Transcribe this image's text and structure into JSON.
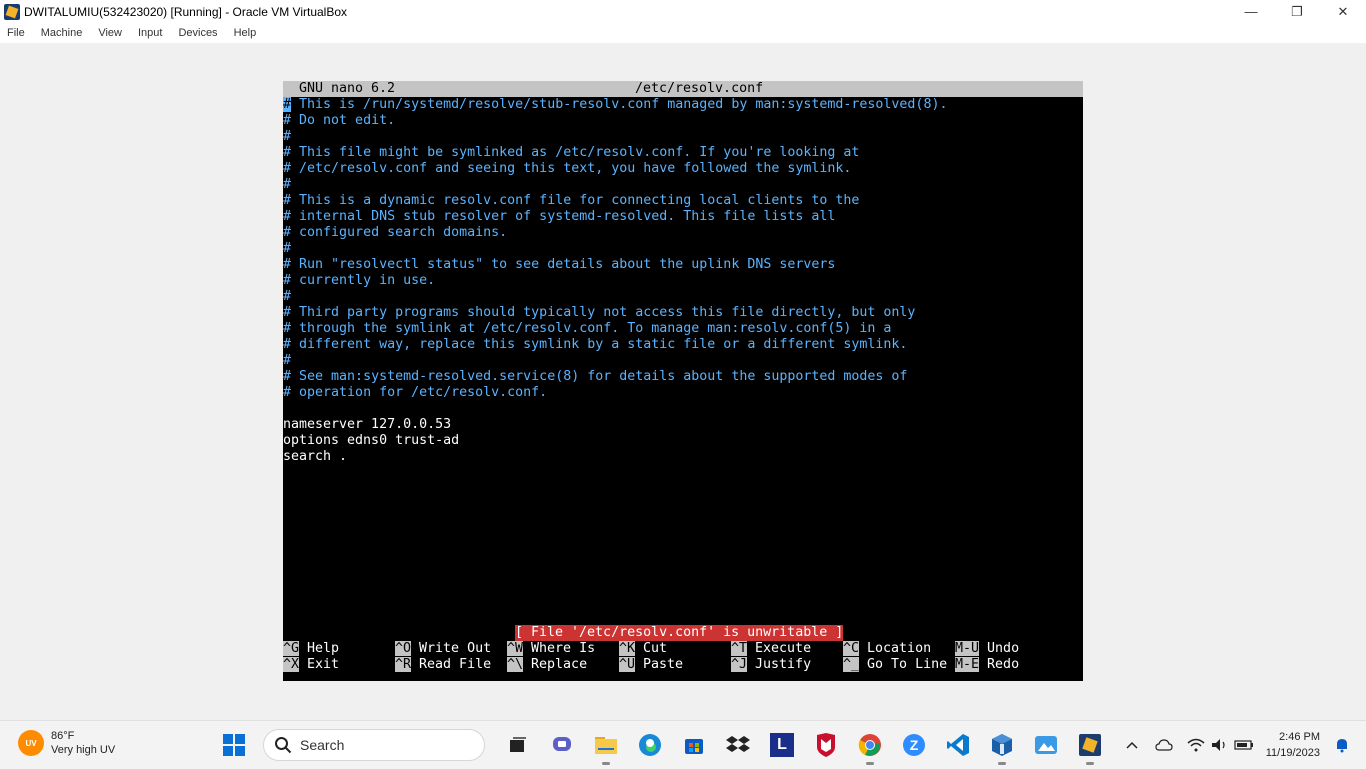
{
  "window": {
    "title": "DWITALUMIU(532423020) [Running] - Oracle VM VirtualBox",
    "minimize": "—",
    "restore": "❐",
    "close": "✕"
  },
  "menu": [
    "File",
    "Machine",
    "View",
    "Input",
    "Devices",
    "Help"
  ],
  "nano": {
    "version": "GNU nano 6.2",
    "filename": "/etc/resolv.conf",
    "comment_lines": [
      " This is /run/systemd/resolve/stub-resolv.conf managed by man:systemd-resolved(8).",
      " Do not edit.",
      "",
      " This file might be symlinked as /etc/resolv.conf. If you're looking at",
      " /etc/resolv.conf and seeing this text, you have followed the symlink.",
      "",
      " This is a dynamic resolv.conf file for connecting local clients to the",
      " internal DNS stub resolver of systemd-resolved. This file lists all",
      " configured search domains.",
      "",
      " Run \"resolvectl status\" to see details about the uplink DNS servers",
      " currently in use.",
      "",
      " Third party programs should typically not access this file directly, but only",
      " through the symlink at /etc/resolv.conf. To manage man:resolv.conf(5) in a",
      " different way, replace this symlink by a static file or a different symlink.",
      "",
      " See man:systemd-resolved.service(8) for details about the supported modes of",
      " operation for /etc/resolv.conf."
    ],
    "config_lines": [
      "nameserver 127.0.0.53",
      "options edns0 trust-ad",
      "search ."
    ],
    "status": "[ File '/etc/resolv.conf' is unwritable ]",
    "shortcuts_row1": [
      {
        "key": "^G",
        "label": "Help"
      },
      {
        "key": "^O",
        "label": "Write Out"
      },
      {
        "key": "^W",
        "label": "Where Is"
      },
      {
        "key": "^K",
        "label": "Cut"
      },
      {
        "key": "^T",
        "label": "Execute"
      },
      {
        "key": "^C",
        "label": "Location"
      },
      {
        "key": "M-U",
        "label": "Undo"
      }
    ],
    "shortcuts_row2": [
      {
        "key": "^X",
        "label": "Exit"
      },
      {
        "key": "^R",
        "label": "Read File"
      },
      {
        "key": "^\\",
        "label": "Replace"
      },
      {
        "key": "^U",
        "label": "Paste"
      },
      {
        "key": "^J",
        "label": "Justify"
      },
      {
        "key": "^_",
        "label": "Go To Line"
      },
      {
        "key": "M-E",
        "label": "Redo"
      }
    ]
  },
  "taskbar": {
    "weather_badge": "UV",
    "weather_temp": "86°F",
    "weather_desc": "Very high UV",
    "search_label": "Search",
    "icons": [
      "windows-start-icon",
      "search",
      "task-view-icon",
      "teams-chat-icon",
      "file-explorer-icon",
      "edge-icon",
      "store-icon",
      "dropbox-icon",
      "l-app-icon",
      "mcafee-icon",
      "chrome-icon",
      "zoom-icon",
      "vscode-icon",
      "virtualbox-icon",
      "paint-icon",
      "virtualbox-vm-icon"
    ],
    "time": "2:46 PM",
    "date": "11/19/2023"
  }
}
